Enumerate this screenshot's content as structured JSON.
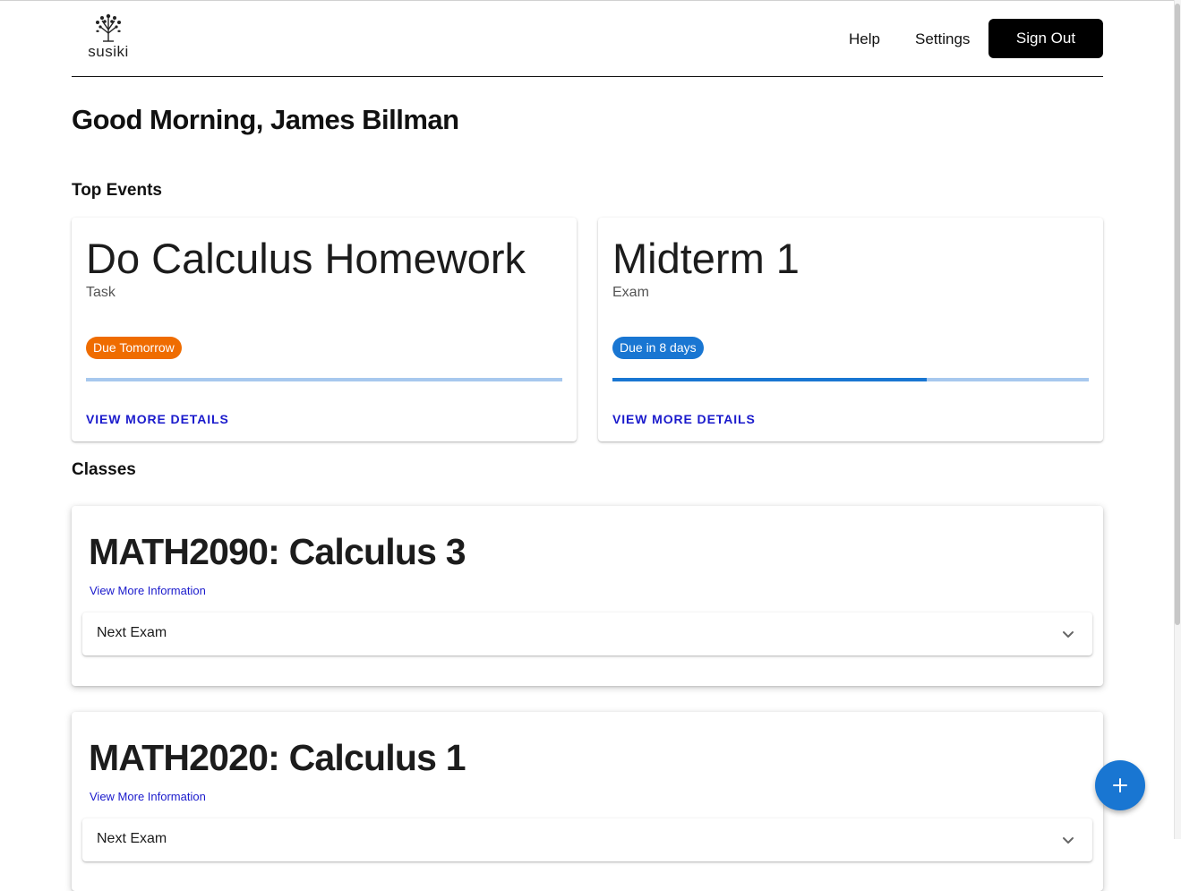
{
  "brand": {
    "logo_text": "susiki"
  },
  "nav": {
    "help": "Help",
    "settings": "Settings",
    "sign_out": "Sign Out"
  },
  "greeting": "Good Morning, James Billman",
  "sections": {
    "top_events": "Top Events",
    "classes": "Classes"
  },
  "events": [
    {
      "title": "Do Calculus Homework",
      "type": "Task",
      "badge": "Due Tomorrow",
      "badge_color": "#ef6c00",
      "progress_percent": 0,
      "link": "View More Details"
    },
    {
      "title": "Midterm 1",
      "type": "Exam",
      "badge": "Due in 8 days",
      "badge_color": "#1976d2",
      "progress_percent": 66,
      "link": "View More Details"
    }
  ],
  "classes": [
    {
      "title": "MATH2090: Calculus 3",
      "link": "View More Information",
      "accordion": "Next Exam"
    },
    {
      "title": "MATH2020: Calculus 1",
      "link": "View More Information",
      "accordion": "Next Exam"
    }
  ],
  "fab": {
    "icon": "plus-icon"
  },
  "colors": {
    "accent": "#1976d2",
    "link": "#1a1acc",
    "primary_button": "#000000"
  }
}
